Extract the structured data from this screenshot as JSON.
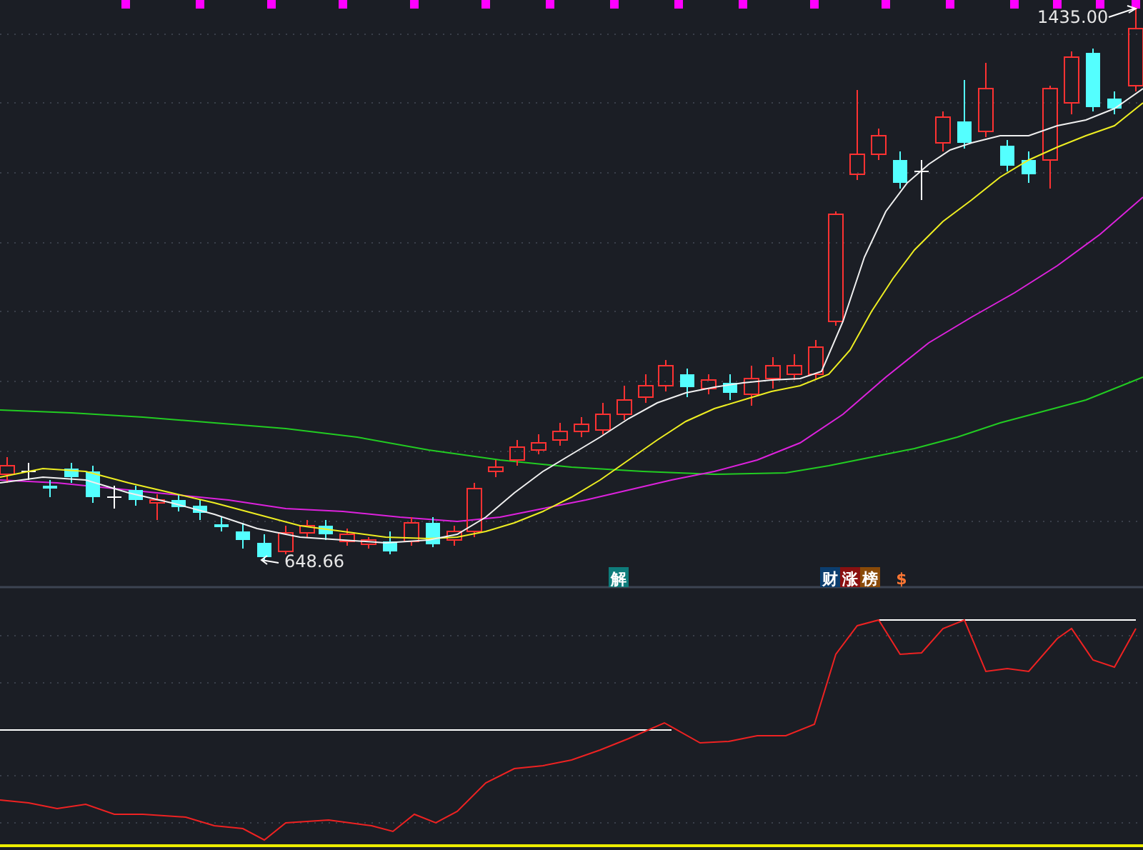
{
  "price_chart": {
    "high_label": "1435.00",
    "low_label": "648.66"
  },
  "signal_badges": [
    {
      "text": "解",
      "color": "#0e7c7b"
    },
    {
      "text": "财",
      "color": "#0b3d6e"
    },
    {
      "text": "涨",
      "color": "#8a1010"
    },
    {
      "text": "榜",
      "color": "#8a4a08"
    },
    {
      "text": "$",
      "color": "#ff7733",
      "kind": "plain"
    }
  ]
}
